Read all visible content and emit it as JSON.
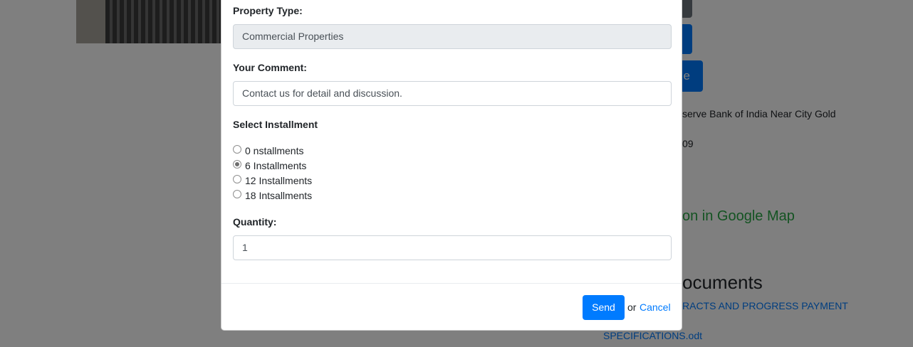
{
  "background": {
    "button_partial_label": "e",
    "address_partial": "serve Bank of India Near City Gold",
    "phone_partial": "09",
    "map_link_partial": "on in Google Map",
    "documents_heading_partial": "ocuments",
    "doc_link_1_partial": "RACTS AND PROGRESS PAYMENT",
    "doc_link_2": "SPECIFICATIONS.odt"
  },
  "modal": {
    "property_type": {
      "label": "Property Type:",
      "value": "Commercial Properties"
    },
    "comment": {
      "label": "Your Comment:",
      "value": "Contact us for detail and discussion."
    },
    "installment": {
      "label": "Select Installment",
      "options": [
        {
          "label": "0 nstallments",
          "checked": false
        },
        {
          "label": "6 Installments",
          "checked": true
        },
        {
          "label": "12 Installments",
          "checked": false
        },
        {
          "label": "18 Intsallments",
          "checked": false
        }
      ]
    },
    "quantity": {
      "label": "Quantity:",
      "value": "1"
    },
    "footer": {
      "send_label": "Send",
      "or_text": "or",
      "cancel_label": "Cancel"
    }
  },
  "colors": {
    "primary": "#007bff",
    "success": "#28a745",
    "overlay": "rgba(0,0,0,0.5)"
  }
}
